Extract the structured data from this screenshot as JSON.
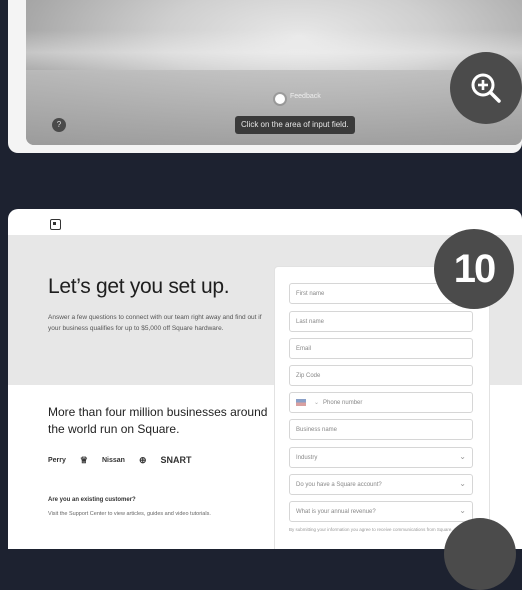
{
  "top": {
    "caption": "Click on the area of input field.",
    "photo_dot_label": "Feedback",
    "small_circle_label": "?"
  },
  "step_badge": "10",
  "hero": {
    "title": "Let’s get you set up.",
    "text": "Answer a few questions to connect with our team right away and find out if your business qualifies for up to $5,000 off Square hardware."
  },
  "sub": {
    "title": "More than four million businesses around the world run on Square.",
    "logos": [
      "Perry",
      "♕",
      "Nissan",
      "⊕",
      "SNART"
    ],
    "faq_question": "Are you an existing customer?",
    "faq_answer": "Visit the Support Center to view articles, guides and video tutorials."
  },
  "form": {
    "fields": [
      {
        "placeholder": "First name"
      },
      {
        "placeholder": "Last name"
      },
      {
        "placeholder": "Email"
      },
      {
        "placeholder": "Zip Code"
      },
      {
        "placeholder": "Phone number"
      },
      {
        "placeholder": "Business name"
      },
      {
        "placeholder": "Industry"
      },
      {
        "placeholder": "Do you have a Square account?"
      },
      {
        "placeholder": "What is your annual revenue?"
      }
    ],
    "note": "By submitting your information you agree to receive communications from Square."
  }
}
